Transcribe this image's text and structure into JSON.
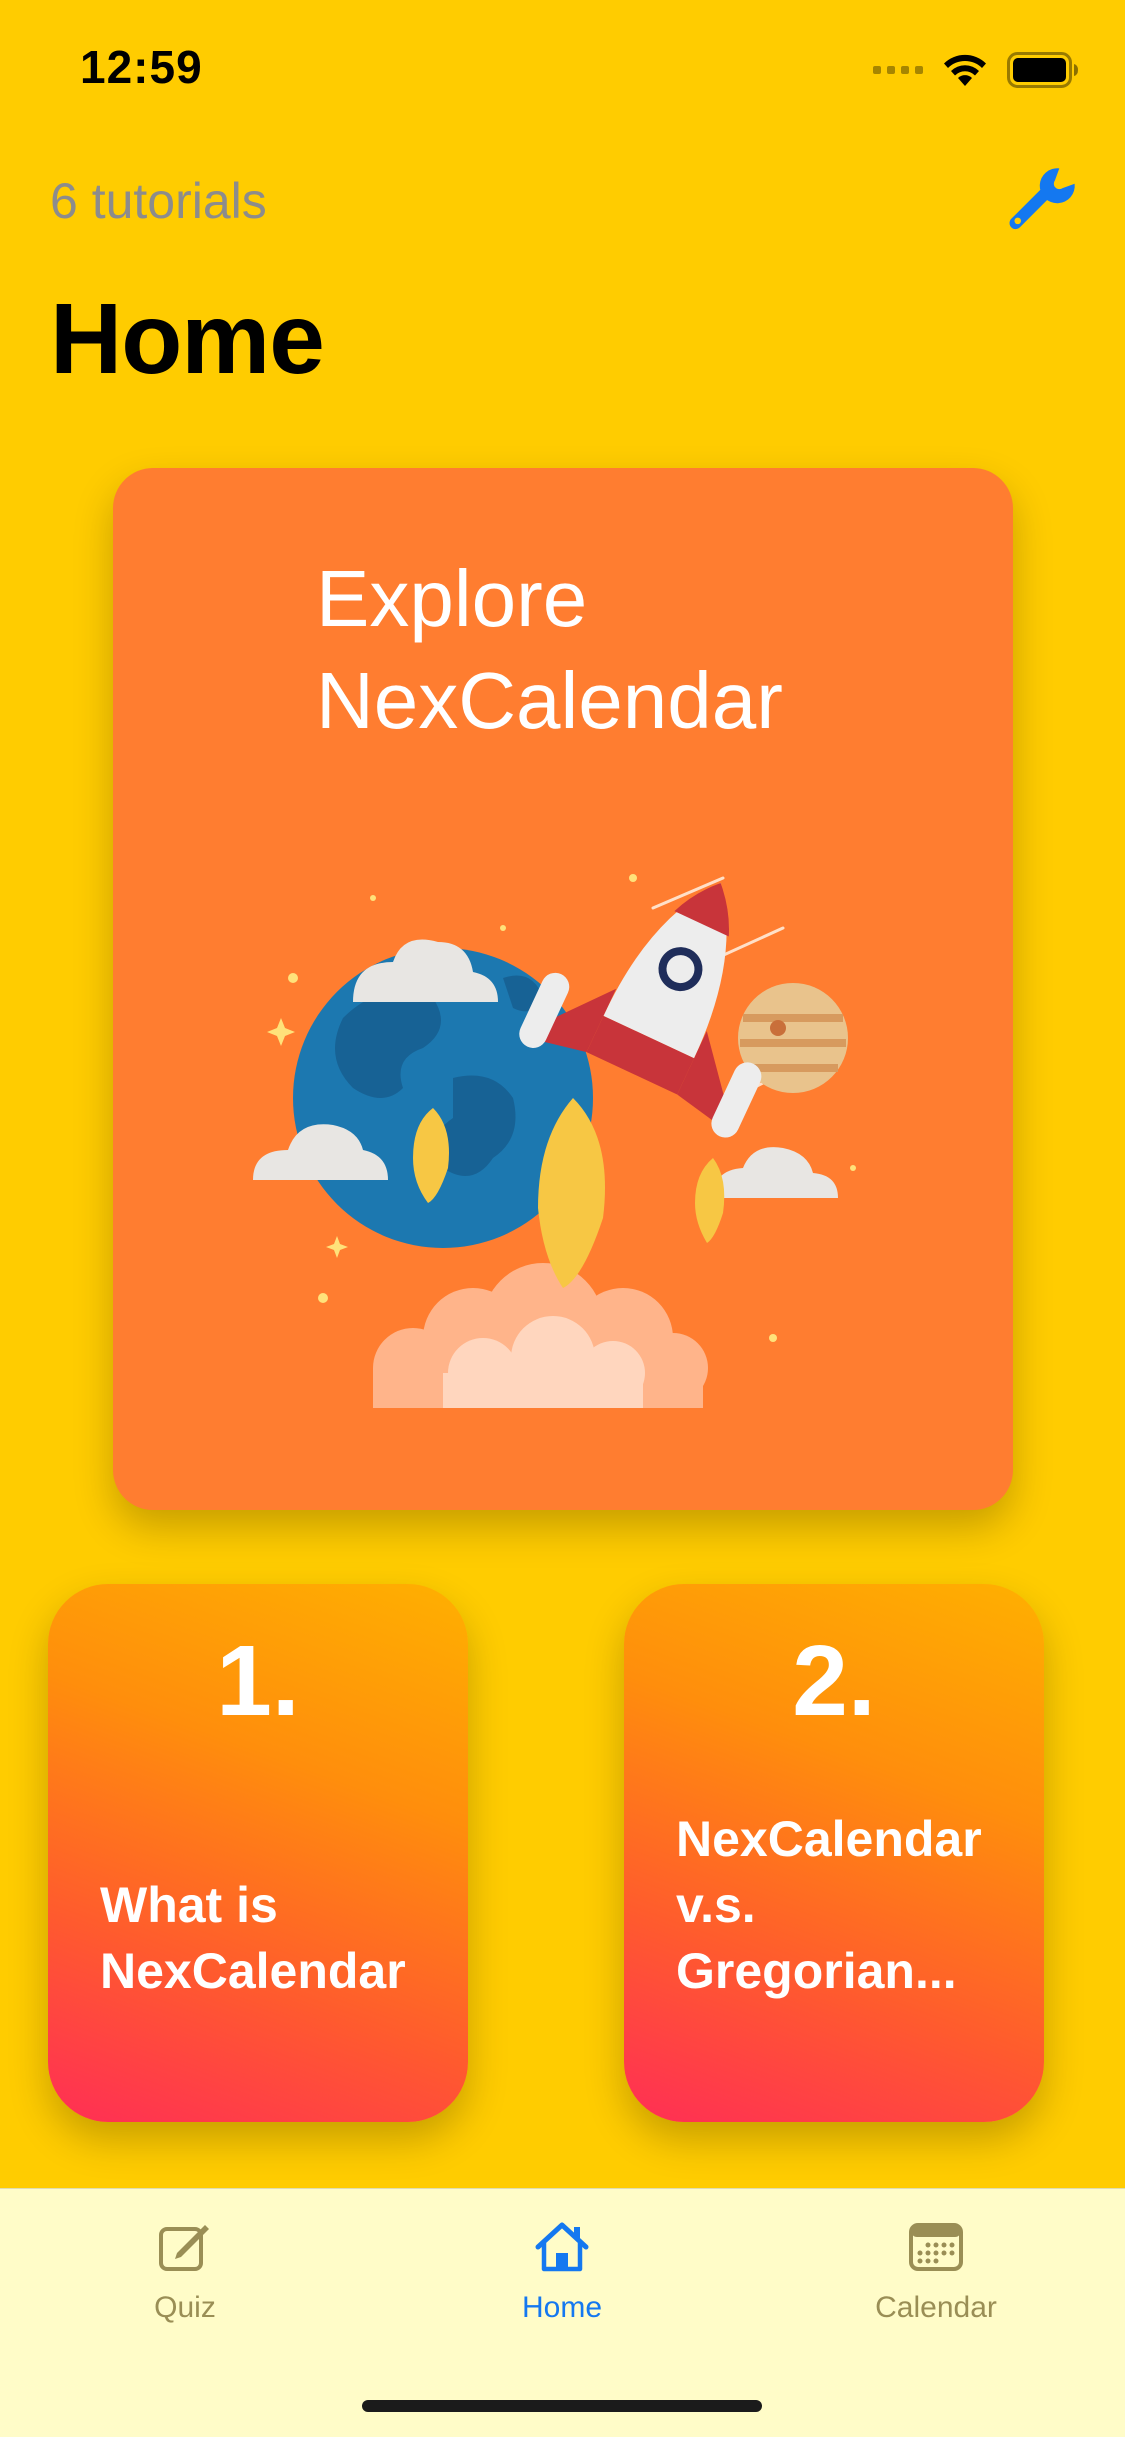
{
  "status_bar": {
    "time": "12:59"
  },
  "header": {
    "subtitle": "6 tutorials",
    "title": "Home",
    "settings_icon": "wrench-icon"
  },
  "hero": {
    "title": "Explore NexCalendar",
    "illustration": "rocket-launch-illustration",
    "background_color": "#FF7D30"
  },
  "tutorials": [
    {
      "number": "1.",
      "title": "What is NexCalendar"
    },
    {
      "number": "2.",
      "title": "NexCalendar v.s. Gregorian..."
    }
  ],
  "tab_bar": {
    "items": [
      {
        "label": "Quiz",
        "icon": "square-pencil-icon",
        "active": false
      },
      {
        "label": "Home",
        "icon": "house-icon",
        "active": true
      },
      {
        "label": "Calendar",
        "icon": "calendar-icon",
        "active": false
      }
    ],
    "active_color": "#1478F0",
    "inactive_color": "#9A8E55"
  },
  "colors": {
    "background": "#FFCC00",
    "tab_bar_background": "#FFFCC8"
  }
}
